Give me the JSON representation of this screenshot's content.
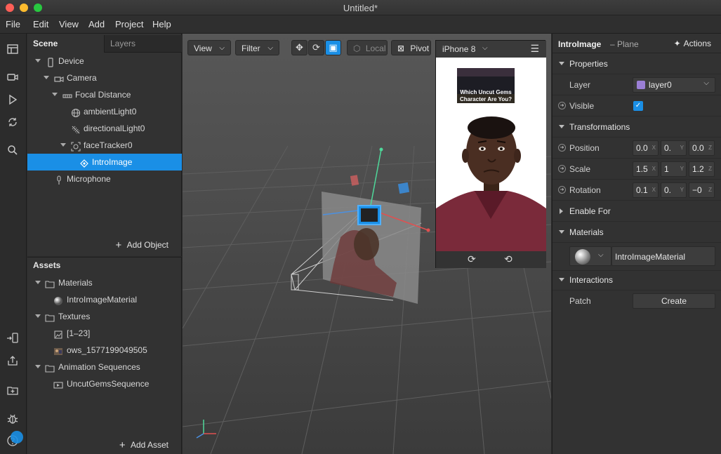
{
  "window": {
    "title": "Untitled*"
  },
  "menu": [
    "File",
    "Edit",
    "View",
    "Add",
    "Project",
    "Help"
  ],
  "scene": {
    "tabs": [
      "Scene",
      "Layers"
    ],
    "items": [
      {
        "label": "Device",
        "icon": "device-icon"
      },
      {
        "label": "Camera",
        "icon": "camera-icon"
      },
      {
        "label": "Focal Distance",
        "icon": "focal-distance-icon"
      },
      {
        "label": "ambientLight0",
        "icon": "ambient-light-icon"
      },
      {
        "label": "directionalLight0",
        "icon": "directional-light-icon"
      },
      {
        "label": "faceTracker0",
        "icon": "face-tracker-icon"
      },
      {
        "label": "IntroImage",
        "icon": "plane-icon",
        "selected": true
      },
      {
        "label": "Microphone",
        "icon": "microphone-icon"
      }
    ],
    "add_object_label": "Add Object"
  },
  "assets": {
    "title": "Assets",
    "items": [
      {
        "label": "Materials",
        "icon": "folder-icon"
      },
      {
        "label": "IntroImageMaterial",
        "icon": "material-sphere-icon"
      },
      {
        "label": "Textures",
        "icon": "folder-icon"
      },
      {
        "label": "[1–23]",
        "icon": "texture-icon"
      },
      {
        "label": "ows_1577199049505",
        "icon": "texture-thumbnail-icon"
      },
      {
        "label": "Animation Sequences",
        "icon": "folder-icon"
      },
      {
        "label": "UncutGemsSequence",
        "icon": "animation-sequence-icon"
      }
    ],
    "add_asset_label": "Add Asset"
  },
  "viewport": {
    "view_label": "View",
    "filter_label": "Filter",
    "local_label": "Local",
    "pivot_label": "Pivot",
    "device_label": "iPhone 8",
    "preview_text": "Which Uncut Gems Character Are You?"
  },
  "inspector": {
    "object_name": "IntroImage",
    "object_type": "– Plane",
    "actions_label": "Actions",
    "properties_label": "Properties",
    "layer_label": "Layer",
    "layer_value": "layer0",
    "layer_color": "#9b7fd6",
    "visible_label": "Visible",
    "transformations_label": "Transformations",
    "position_label": "Position",
    "position": [
      "0.0",
      "0.",
      "0.0"
    ],
    "scale_label": "Scale",
    "scale": [
      "1.5",
      "1",
      "1.2"
    ],
    "rotation_label": "Rotation",
    "rotation": [
      "0.1",
      "0.",
      "−0"
    ],
    "axes": [
      "X",
      "Y",
      "Z"
    ],
    "enable_for_label": "Enable For",
    "materials_label": "Materials",
    "material_value": "IntroImageMaterial",
    "interactions_label": "Interactions",
    "patch_label": "Patch",
    "create_label": "Create"
  },
  "colors": {
    "accent": "#1a8fe6"
  }
}
